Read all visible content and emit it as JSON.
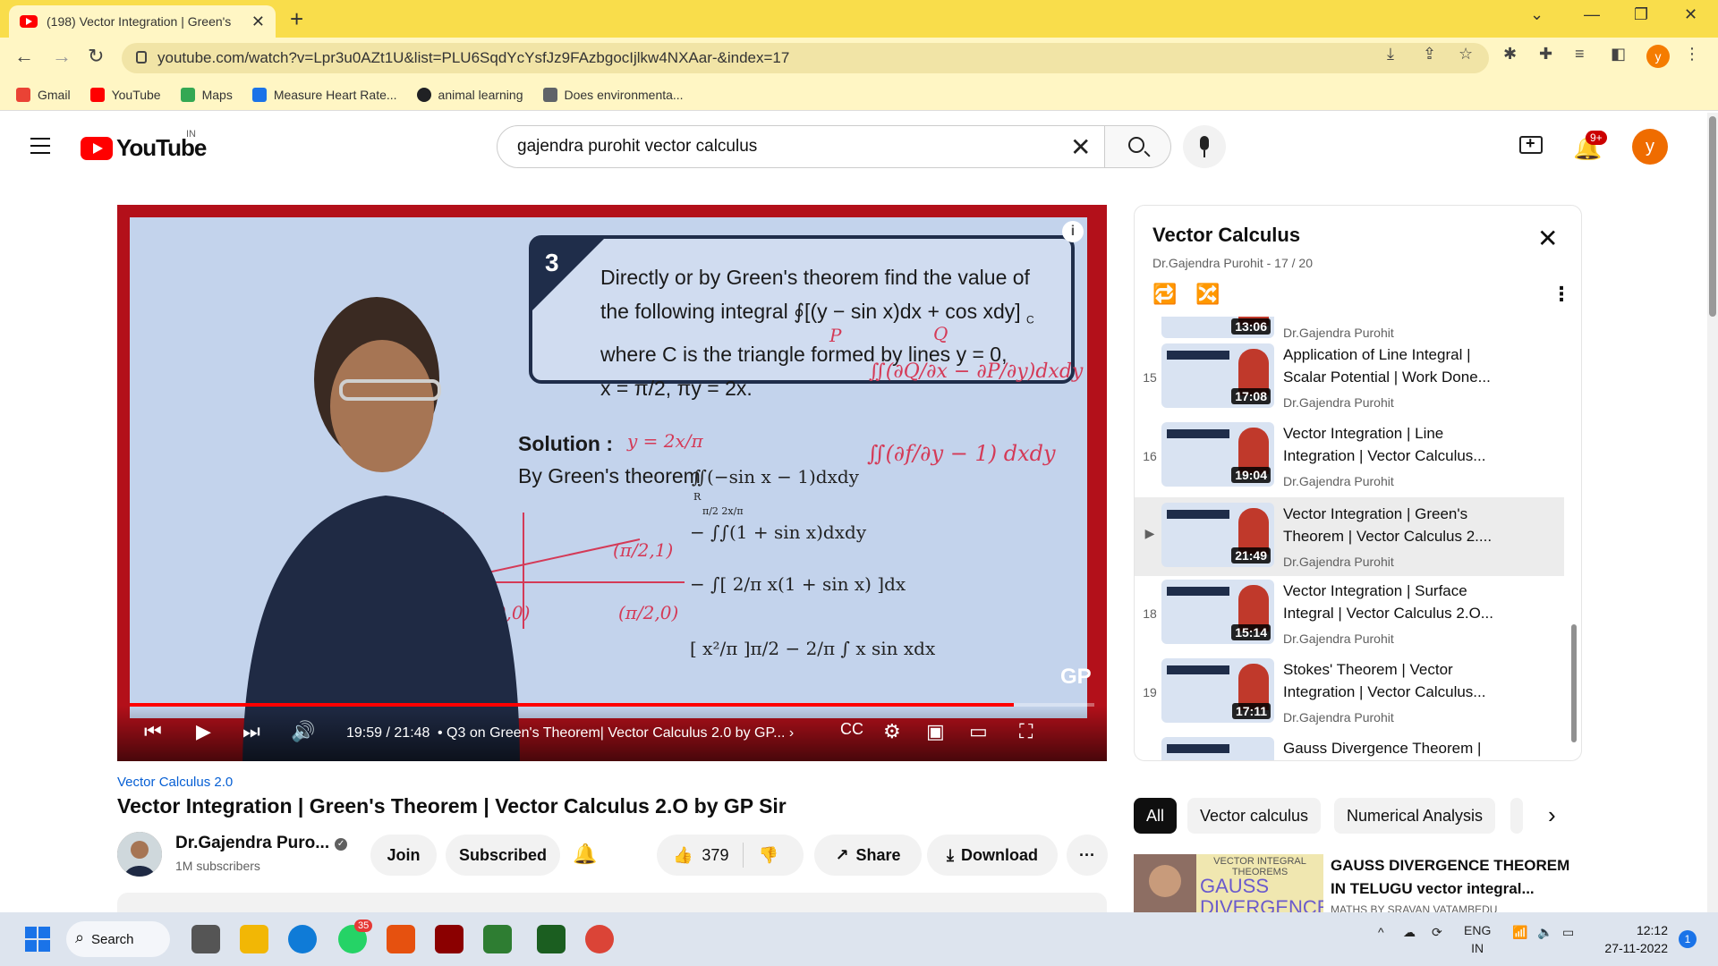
{
  "browser": {
    "tab_title": "(198) Vector Integration | Green's",
    "url": "youtube.com/watch?v=Lpr3u0AZt1U&list=PLU6SqdYcYsfJz9FAzbgocIjlkw4NXAar-&index=17",
    "profile_initial": "y",
    "bookmarks": [
      {
        "label": "Gmail",
        "color": "#ea4335"
      },
      {
        "label": "YouTube",
        "color": "#ff0000"
      },
      {
        "label": "Maps",
        "color": "#34a853"
      },
      {
        "label": "Measure Heart Rate...",
        "color": "#1a73e8"
      },
      {
        "label": "animal learning",
        "color": "#202124"
      },
      {
        "label": "Does environmenta...",
        "color": "#5f6368"
      }
    ]
  },
  "youtube": {
    "logo_text": "YouTube",
    "country": "IN",
    "search_query": "gajendra purohit vector calculus",
    "notification_count": "9+",
    "avatar_initial": "y"
  },
  "player": {
    "question_number": "3",
    "question_line1": "Directly or by Green's theorem find the value of",
    "question_line2": "the following integral ∮[(y − sin x)dx + cos xdy]",
    "question_line2_sub": "C",
    "question_line3": "where C is the triangle formed by lines y = 0,",
    "question_line4": "x = π/2, πy = 2x.",
    "solution_label": "Solution :",
    "green_label": "By Green's theorem",
    "green_integral": "∬(−sin x − 1)dxdy",
    "green_integral_sub": "R",
    "math_line1": "− ∫∫(1 + sin x)dxdy",
    "math_line1_limits": "π/2  2x/π",
    "math_line2": "− ∫[ 2/π x(1 + sin x) ]dx",
    "math_line3": "[ x²/π ]π/2 − 2/π ∫ x sin xdx",
    "ink_notes": [
      "y = 2x/π",
      "∬(∂Q/∂x − ∂P/∂y)dxdy",
      "∬(∂f/∂y − 1) dxdy",
      "(π/2,1)",
      "(0,0)",
      "(π/2,0)",
      "P",
      "Q"
    ],
    "time_current": "19:59",
    "time_total": "21:48",
    "progress": 0.9169,
    "chapter": "• Q3 on Green's Theorem| Vector Calculus 2.0 by GP...",
    "chapter_arrow": "›",
    "watermark": "GP",
    "info_icon": "i"
  },
  "video": {
    "playlist_link": "Vector Calculus 2.0",
    "title": "Vector Integration | Green's Theorem | Vector Calculus 2.O by GP Sir",
    "channel": "Dr.Gajendra Puro...",
    "subscribers": "1M subscribers",
    "join_label": "Join",
    "subscribed_label": "Subscribed",
    "likes": "379",
    "share_label": "Share",
    "download_label": "Download",
    "more_label": "···"
  },
  "playlist": {
    "title": "Vector Calculus",
    "subtitle": "Dr.Gajendra Purohit - 17 / 20",
    "items": [
      {
        "index": "",
        "title": "",
        "channel": "Dr.Gajendra Purohit",
        "duration": "13:06",
        "active": false
      },
      {
        "index": "15",
        "title": "Application of Line Integral | Scalar Potential | Work Done...",
        "channel": "Dr.Gajendra Purohit",
        "duration": "17:08",
        "active": false
      },
      {
        "index": "16",
        "title": "Vector Integration | Line Integration | Vector Calculus...",
        "channel": "Dr.Gajendra Purohit",
        "duration": "19:04",
        "active": false
      },
      {
        "index": "▶",
        "title": "Vector Integration | Green's Theorem | Vector Calculus 2....",
        "channel": "Dr.Gajendra Purohit",
        "duration": "21:49",
        "active": true
      },
      {
        "index": "18",
        "title": "Vector Integration | Surface Integral | Vector Calculus 2.O...",
        "channel": "Dr.Gajendra Purohit",
        "duration": "15:14",
        "active": false
      },
      {
        "index": "19",
        "title": "Stokes' Theorem | Vector Integration | Vector Calculus...",
        "channel": "Dr.Gajendra Purohit",
        "duration": "17:11",
        "active": false
      },
      {
        "index": "",
        "title": "Gauss Divergence Theorem |",
        "channel": "",
        "duration": "",
        "active": false
      }
    ]
  },
  "chips": [
    "All",
    "Vector calculus",
    "Numerical Analysis"
  ],
  "recommendation": {
    "thumb_caption": "VECTOR INTEGRAL THEOREMS",
    "thumb_big": "GAUSS DIVERGENCE",
    "title": "GAUSS DIVERGENCE THEOREM IN TELUGU vector integral...",
    "channel": "MATHS BY SRAVAN VATAMBEDU"
  },
  "taskbar": {
    "search_label": "Search",
    "whatsapp_badge": "35",
    "lang_line1": "ENG",
    "lang_line2": "IN",
    "time": "12:12",
    "date": "27-11-2022",
    "notif": "1"
  }
}
